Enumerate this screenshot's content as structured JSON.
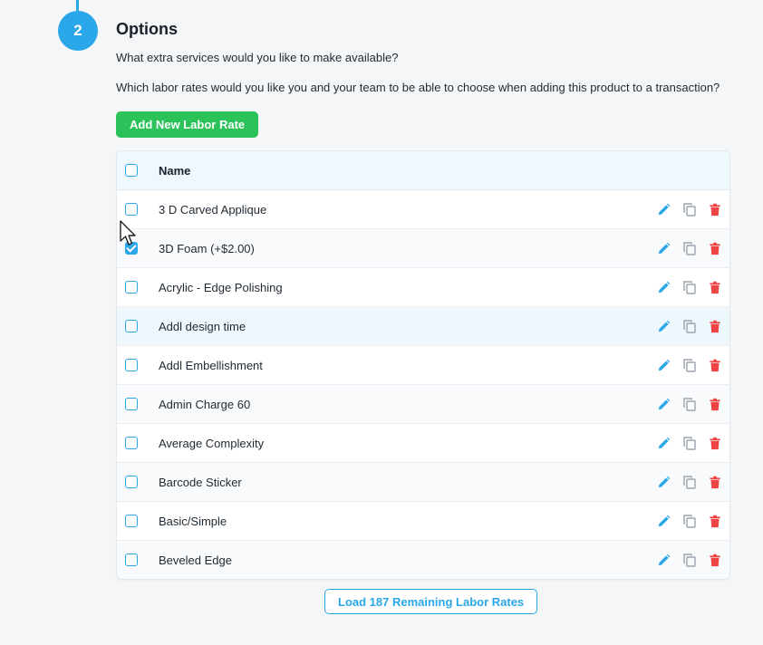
{
  "step": {
    "number": "2",
    "title": "Options"
  },
  "subtitle": "What extra services would you like to make available?",
  "question": "Which labor rates would you like you and your team to be able to choose when adding this product to a transaction?",
  "add_button": "Add New Labor Rate",
  "table": {
    "header": "Name",
    "rows": [
      {
        "name": "3 D Carved Applique",
        "checked": false
      },
      {
        "name": "3D Foam (+$2.00)",
        "checked": true
      },
      {
        "name": "Acrylic - Edge Polishing",
        "checked": false
      },
      {
        "name": "Addl design time",
        "checked": false
      },
      {
        "name": "Addl Embellishment",
        "checked": false
      },
      {
        "name": "Admin Charge 60",
        "checked": false
      },
      {
        "name": "Average Complexity",
        "checked": false
      },
      {
        "name": "Barcode Sticker",
        "checked": false
      },
      {
        "name": "Basic/Simple",
        "checked": false
      },
      {
        "name": "Beveled Edge",
        "checked": false
      }
    ]
  },
  "load_button": "Load 187 Remaining Labor Rates",
  "colors": {
    "accent": "#29a7e8",
    "primary_button": "#2bc25a",
    "delete": "#ef4444",
    "copy": "#9aa3ad"
  },
  "icons": {
    "edit": "pencil-icon",
    "copy": "copy-icon",
    "delete": "trash-icon",
    "cursor": "mouse-pointer-icon"
  }
}
